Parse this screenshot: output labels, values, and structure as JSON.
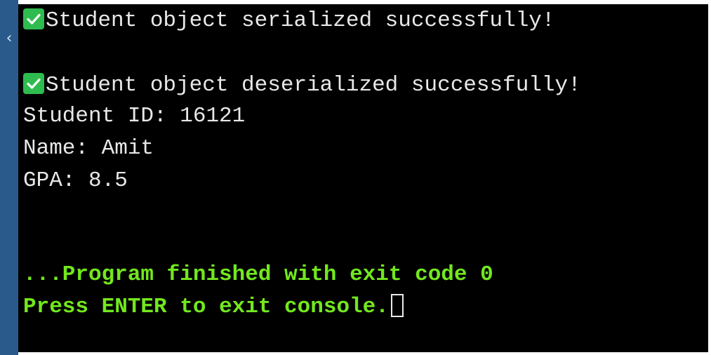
{
  "console": {
    "serialized_msg": "Student object serialized successfully!",
    "deserialized_msg": "Student object deserialized successfully!",
    "student_id_line": "Student ID: 16121",
    "name_line": "Name: Amit",
    "gpa_line": "GPA: 8.5",
    "finished_line": "...Program finished with exit code 0",
    "press_enter_line": "Press ENTER to exit console."
  },
  "icons": {
    "check": "check-mark-icon",
    "side_chevron": "chevron-left-icon"
  },
  "colors": {
    "console_background": "#000000",
    "output_text": "#e8e8e8",
    "status_text": "#72e81d",
    "check_badge": "#2ebc4f",
    "side_panel": "#2a5a8c"
  }
}
